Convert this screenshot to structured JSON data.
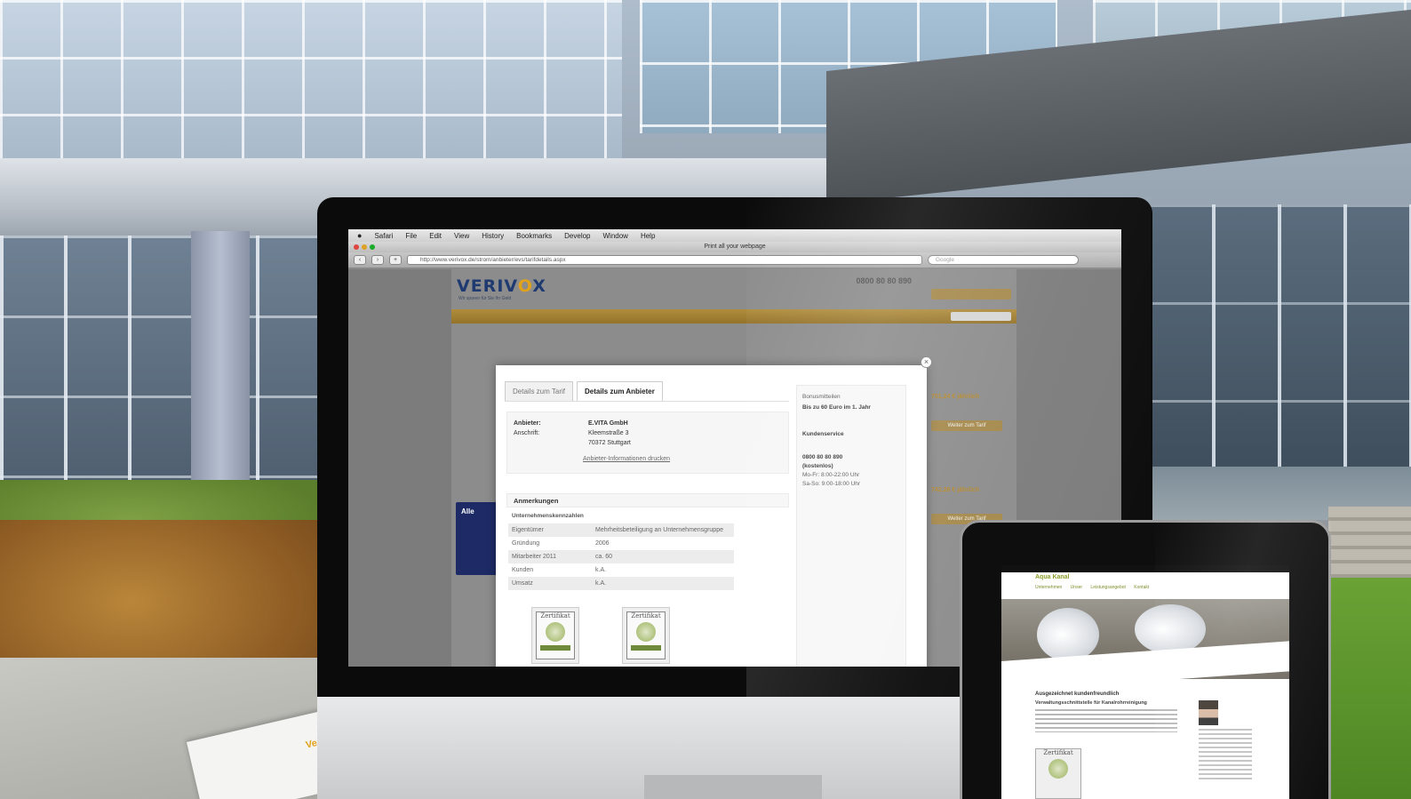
{
  "browser": {
    "menu_items": [
      "Safari",
      "File",
      "Edit",
      "View",
      "History",
      "Bookmarks",
      "Develop",
      "Window",
      "Help"
    ],
    "window_title": "Print all your webpage",
    "url": "http://www.verivox.de/strom/anbieter/evs/tarifdetails.aspx",
    "search_placeholder": "Google",
    "traffic_colors": [
      "#e0443e",
      "#dea123",
      "#1aab29"
    ]
  },
  "site": {
    "logo_text_a": "VERIV",
    "logo_text_o": "O",
    "logo_text_b": "X",
    "tagline": "Wir sparen für Sie Ihr Geld",
    "hotline": "0800 80 80 890",
    "brand_color": "#1f3a70",
    "accent_color": "#e0a21b"
  },
  "modal": {
    "tab_inactive": "Details zum Tarif",
    "tab_active": "Details zum Anbieter",
    "close_glyph": "×",
    "provider_label": "Anbieter:",
    "provider_value": "E.VITA GmbH",
    "address_label": "Anschrift:",
    "address_line1": "Kleemstraße 3",
    "address_line2": "70372 Stuttgart",
    "print_link": "Anbieter-Informationen drucken",
    "remarks_title": "Anmerkungen",
    "company_title": "Unternehmenskennzahlen",
    "company_rows": [
      {
        "k": "Eigentümer",
        "v": "Mehrheitsbeteiligung an Unternehmensgruppe"
      },
      {
        "k": "Gründung",
        "v": "2006"
      },
      {
        "k": "Mitarbeiter 2011",
        "v": "ca. 60"
      },
      {
        "k": "Kunden",
        "v": "k.A."
      },
      {
        "k": "Umsatz",
        "v": "k.A."
      }
    ],
    "cert_label": "Zertifikat",
    "right_panel": {
      "bonus_label": "Bonusmitteilen",
      "bonus_value": "Bis zu 60 Euro im 1. Jahr",
      "service_title": "Kundenservice",
      "phone": "0800 80 80 890",
      "phone_note": "(kostenlos)",
      "hours_1": "Mo-Fr: 8:00-22:00 Uhr",
      "hours_2": "Sa-So: 9:00-18:00 Uhr"
    }
  },
  "background_page": {
    "price_1": "751,24 € jährlich",
    "price_2": "742,26 € jährlich",
    "button_label": "Weiter zum Tarif",
    "blue_box_title": "Alle"
  },
  "ipad": {
    "logo": "Aqua Kanal",
    "menu": "Unternehmen Unser Leistungsangebot Kontakt",
    "heading": "Ausgezeichnet kundenfreundlich",
    "subheading": "Verwaltungsschnittstelle für Kanalrohrreinigung",
    "cert_label": "Zertifikat"
  },
  "paper": {
    "logo": "Verivox"
  }
}
